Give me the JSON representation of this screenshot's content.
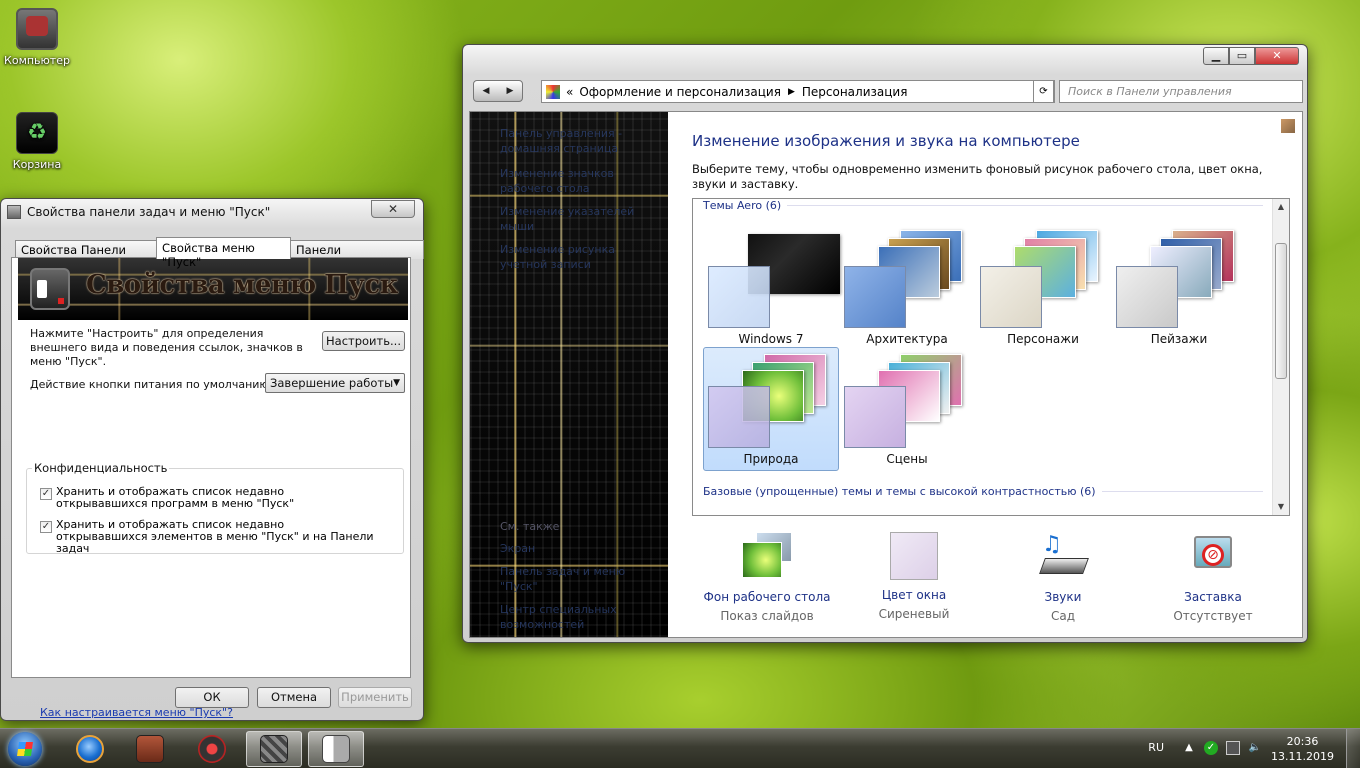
{
  "desktop": {
    "icons": [
      {
        "label": "Компьютер"
      },
      {
        "label": "Корзина"
      }
    ]
  },
  "control_panel": {
    "address": {
      "prefix": "«",
      "crumbs": [
        "Оформление и персонализация",
        "Персонализация"
      ]
    },
    "search_placeholder": "Поиск в Панели управления",
    "left_links": [
      "Панель управления - домашняя страница",
      "Изменение значков рабочего стола",
      "Изменение указателей мыши",
      "Изменение рисунка учетной записи"
    ],
    "see_also": {
      "title": "См. также",
      "links": [
        "Экран",
        "Панель задач и меню \"Пуск\"",
        "Центр специальных возможностей"
      ]
    },
    "heading": "Изменение изображения и звука на компьютере",
    "description": "Выберите тему, чтобы одновременно изменить фоновый рисунок рабочего стола, цвет окна, звуки и заставку.",
    "aero_group": "Темы Aero (6)",
    "themes": [
      {
        "name": "Windows 7",
        "colors": [
          "#1a1a1a",
          "#333",
          "#555"
        ],
        "selected": false
      },
      {
        "name": "Архитектура",
        "colors": [
          "#3b6fb8",
          "#c8a050",
          "#8ab4e8"
        ],
        "selected": false
      },
      {
        "name": "Персонажи",
        "colors": [
          "#4aa7e0",
          "#e07fa6",
          "#aedc6b"
        ],
        "selected": false
      },
      {
        "name": "Пейзажи",
        "colors": [
          "#2e5ea8",
          "#d9b08c",
          "#b4325c"
        ],
        "selected": false
      },
      {
        "name": "Природа",
        "colors": [
          "#6fbf3a",
          "#d06aa8",
          "#3aa070"
        ],
        "selected": true
      },
      {
        "name": "Сцены",
        "colors": [
          "#e070b0",
          "#4ab0d8",
          "#8ed06a"
        ],
        "selected": false
      }
    ],
    "basic_group": "Базовые (упрощенные) темы и темы с высокой контрастностью (6)",
    "tiles": [
      {
        "label": "Фон рабочего стола",
        "sub": "Показ слайдов"
      },
      {
        "label": "Цвет окна",
        "sub": "Сиреневый"
      },
      {
        "label": "Звуки",
        "sub": "Сад"
      },
      {
        "label": "Заставка",
        "sub": "Отсутствует"
      }
    ]
  },
  "dialog": {
    "title": "Свойства панели задач и меню \"Пуск\"",
    "close": "✕",
    "tabs": [
      "Свойства Панели задач",
      "Свойства меню \"Пуск\"",
      "Панели инструментов"
    ],
    "banner_title": "Свойства меню Пуск",
    "customize_text": "Нажмите \"Настроить\" для определения внешнего вида и поведения ссылок, значков в меню \"Пуск\".",
    "customize_button": "Настроить...",
    "power_label": "Действие кнопки питания по умолчанию:",
    "power_value": "Завершение работы",
    "privacy_title": "Конфиденциальность",
    "checks": [
      {
        "label": "Хранить и отображать список недавно открывавшихся программ в меню \"Пуск\"",
        "checked": true
      },
      {
        "label": "Хранить и отображать список недавно открывавшихся элементов в меню \"Пуск\" и на Панели задач",
        "checked": true
      }
    ],
    "help_link": "Как настраивается меню \"Пуск\"?",
    "ok": "ОК",
    "cancel": "Отмена",
    "apply": "Применить"
  },
  "taskbar": {
    "lang": "RU",
    "time": "20:36",
    "date": "13.11.2019"
  }
}
